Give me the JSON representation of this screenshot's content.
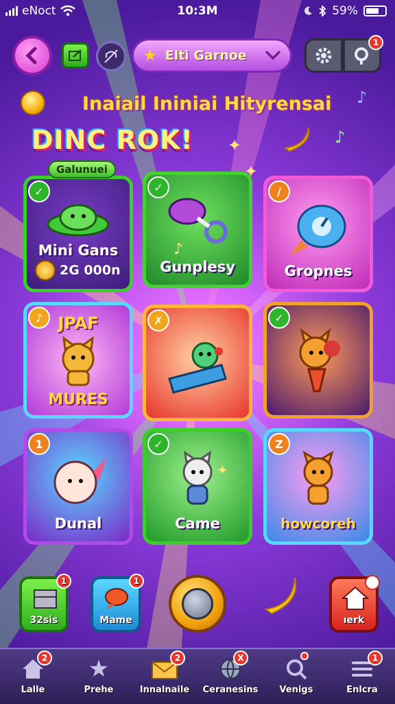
{
  "status_bar": {
    "carrier": "eNoct",
    "time": "10:3M",
    "battery": "59%"
  },
  "header": {
    "dropdown_title": "Elti Garnoe",
    "notif_badge": "1"
  },
  "headline": "Inaiail Ininiai Hityrensai",
  "big_title": "DINC ROK!",
  "chip_label": "Galunuei",
  "grid": [
    {
      "label": "Mini Gans",
      "sub": "2G 000n",
      "badge": "✓",
      "theme": "green"
    },
    {
      "label": "Gunplesy",
      "badge": "✓",
      "theme": "green"
    },
    {
      "label": "Gropnes",
      "badge": "/",
      "theme": "pink"
    },
    {
      "label": "JPAF",
      "sub": "MURES",
      "badge": "♪",
      "theme": "purple"
    },
    {
      "label": "",
      "badge": "✗",
      "theme": "red"
    },
    {
      "label": "",
      "badge": "✓",
      "theme": "dark"
    },
    {
      "label": "Dunal",
      "badge": "1",
      "theme": "purple"
    },
    {
      "label": "Came",
      "badge": "✓",
      "theme": "green"
    },
    {
      "label": "howcoreh",
      "badge": "Z",
      "theme": "blue"
    }
  ],
  "quick": [
    {
      "label": "32sis",
      "badge": "1"
    },
    {
      "label": "Mame",
      "badge": "1"
    },
    {
      "label": "ıerk",
      "badge": ""
    }
  ],
  "tabs": [
    {
      "label": "Lalle",
      "badge": "2",
      "icon": "home-icon"
    },
    {
      "label": "Prehe",
      "badge": "",
      "icon": "star-icon"
    },
    {
      "label": "Innalnaile",
      "badge": "2",
      "icon": "mail-icon"
    },
    {
      "label": "Ceranesins",
      "badge": "X",
      "icon": "globe-icon"
    },
    {
      "label": "Venigs",
      "badge": "•",
      "icon": "search-icon"
    },
    {
      "label": "Enlcra",
      "badge": "1",
      "icon": "menu-icon"
    }
  ]
}
